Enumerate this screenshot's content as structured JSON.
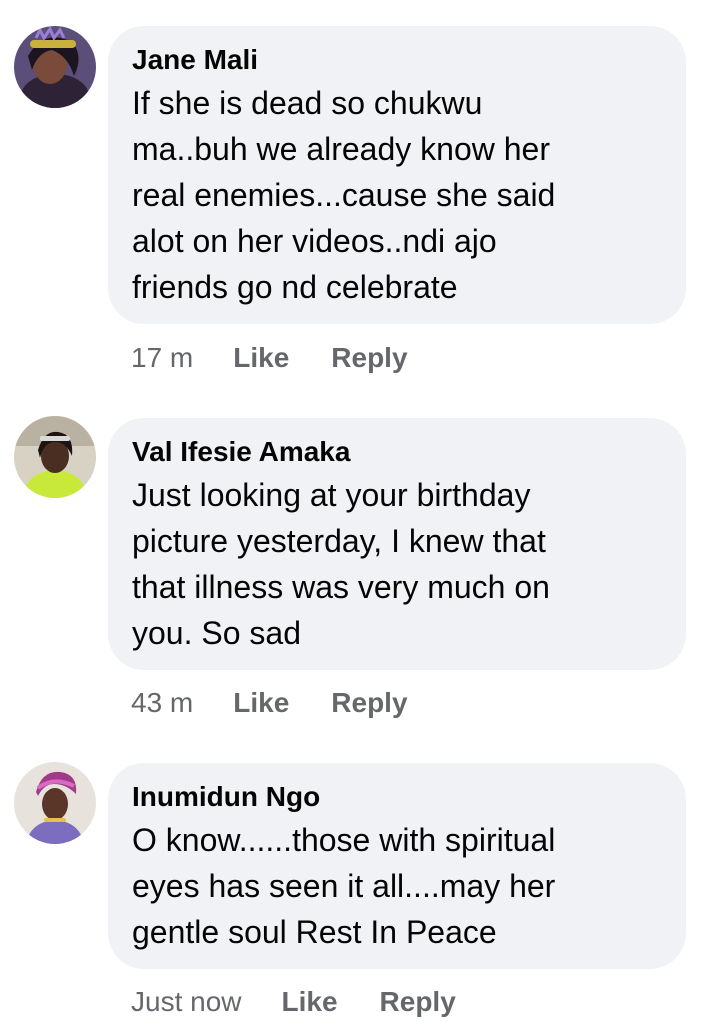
{
  "comments": [
    {
      "author": "Jane Mali",
      "lines": [
        "If she is dead so chukwu",
        "ma..buh we already know her",
        "real enemies...cause she said",
        "alot on her videos..ndi ajo",
        "friends go nd celebrate"
      ],
      "time": "17 m",
      "like_label": "Like",
      "reply_label": "Reply",
      "avatar_icon": "profile-photo"
    },
    {
      "author": "Val Ifesie Amaka",
      "lines": [
        "Just looking at your birthday",
        "picture yesterday, I knew that",
        "that illness was very much on",
        "you. So sad"
      ],
      "time": "43 m",
      "like_label": "Like",
      "reply_label": "Reply",
      "avatar_icon": "profile-photo"
    },
    {
      "author": "Inumidun Ngo",
      "lines": [
        "O know......those with spiritual",
        "eyes has seen it all....may her",
        "gentle soul Rest In Peace"
      ],
      "time": "Just now",
      "like_label": "Like",
      "reply_label": "Reply",
      "avatar_icon": "profile-photo"
    }
  ],
  "colors": {
    "bubble_bg": "#f0f2f5",
    "text": "#050505",
    "meta": "#65676b"
  }
}
